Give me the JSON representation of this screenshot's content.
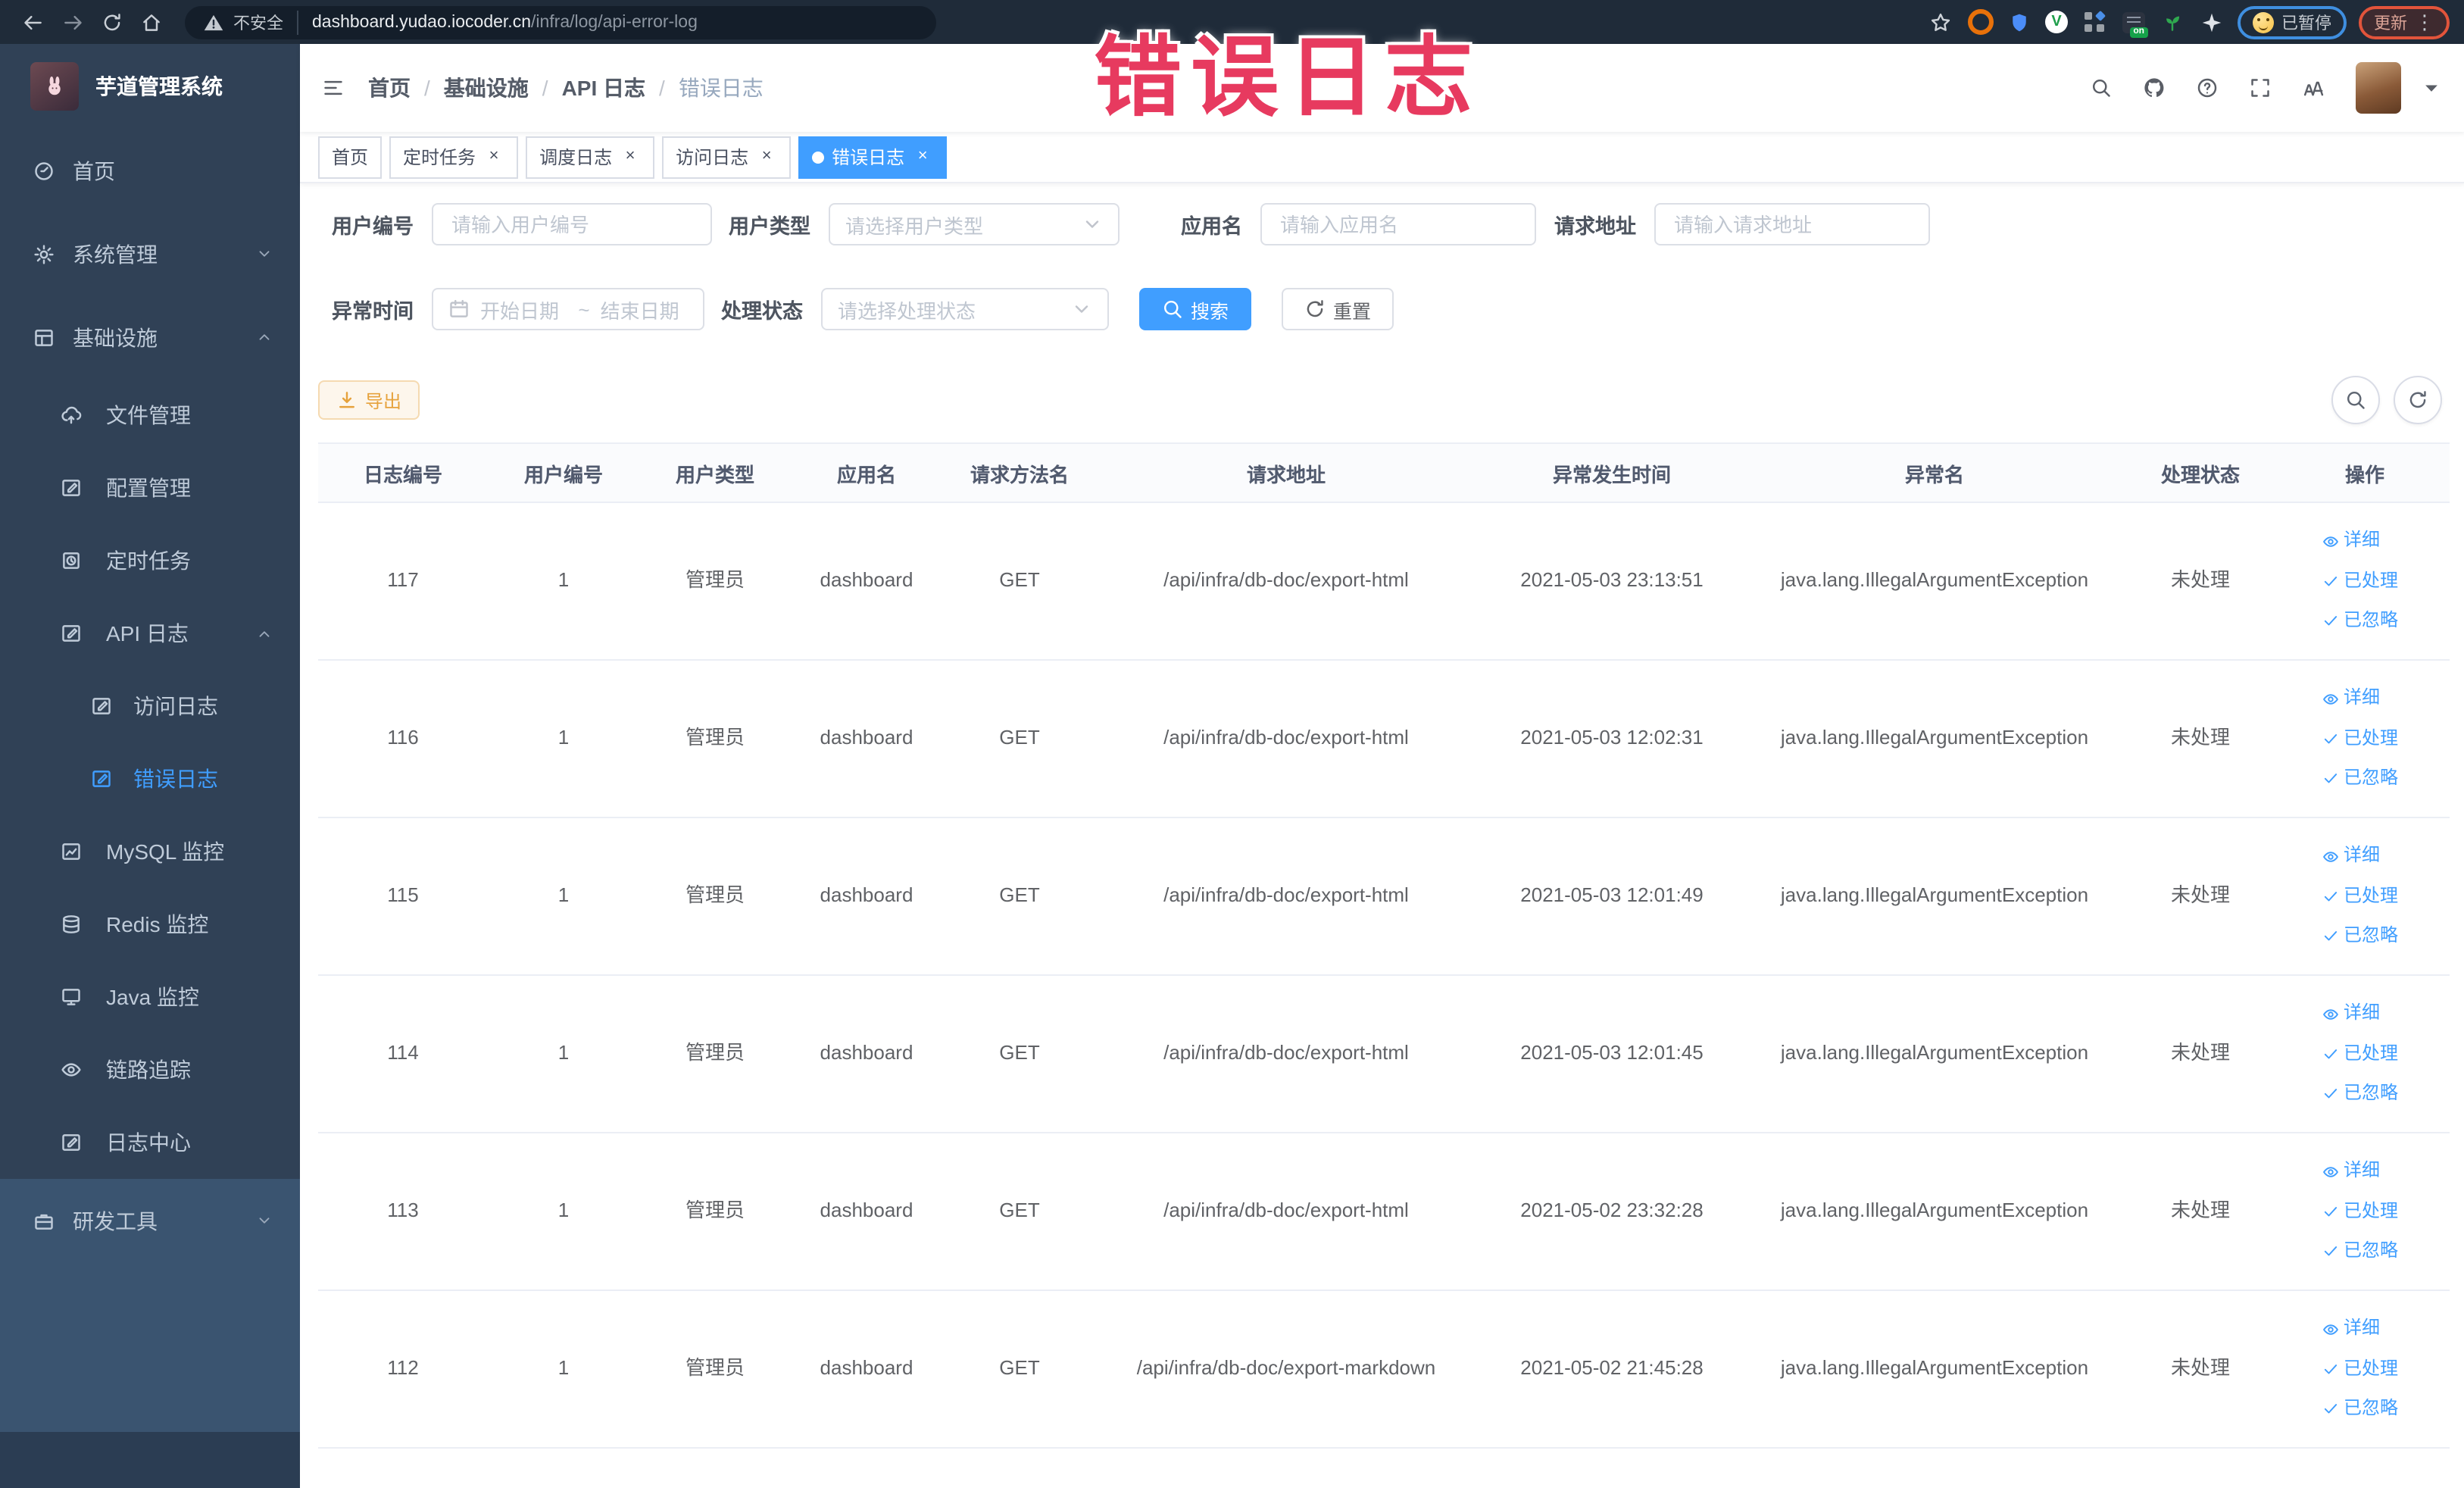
{
  "browser": {
    "security_label": "不安全",
    "url_host": "dashboard.yudao.iocoder.cn",
    "url_path": "/infra/log/api-error-log",
    "paused_label": "已暂停",
    "update_label": "更新",
    "on_badge": "on",
    "ext_v_letter": "V"
  },
  "annotation": {
    "text": "错误日志",
    "color": "#e73a5f"
  },
  "glyphs": {
    "close": "×",
    "kebab": "⋮",
    "slash": "/"
  },
  "sidebar": {
    "title": "芋道管理系统",
    "items": [
      {
        "label": "首页",
        "icon": "dashboard",
        "level": 1
      },
      {
        "label": "系统管理",
        "icon": "gear",
        "level": 1,
        "chevron": "down"
      },
      {
        "label": "基础设施",
        "icon": "infra",
        "level": 1,
        "chevron": "up"
      },
      {
        "label": "文件管理",
        "icon": "cloud",
        "level": 2
      },
      {
        "label": "配置管理",
        "icon": "pen",
        "level": 2
      },
      {
        "label": "定时任务",
        "icon": "job",
        "level": 2
      },
      {
        "label": "API 日志",
        "icon": "pen",
        "level": 2,
        "chevron": "up"
      },
      {
        "label": "访问日志",
        "icon": "pen",
        "level": 3
      },
      {
        "label": "错误日志",
        "icon": "pen",
        "level": 3,
        "active": true
      },
      {
        "label": "MySQL 监控",
        "icon": "mysql",
        "level": 2
      },
      {
        "label": "Redis 监控",
        "icon": "redis",
        "level": 2
      },
      {
        "label": "Java 监控",
        "icon": "java",
        "level": 2
      },
      {
        "label": "链路追踪",
        "icon": "trace",
        "level": 2
      },
      {
        "label": "日志中心",
        "icon": "pen",
        "level": 2
      }
    ],
    "bottom_item": {
      "label": "研发工具",
      "icon": "briefcase",
      "level": 1,
      "chevron": "down"
    }
  },
  "header": {
    "breadcrumb": [
      "首页",
      "基础设施",
      "API 日志",
      "错误日志"
    ]
  },
  "tabs": [
    {
      "label": "首页",
      "closable": false,
      "active": false
    },
    {
      "label": "定时任务",
      "closable": true,
      "active": false
    },
    {
      "label": "调度日志",
      "closable": true,
      "active": false
    },
    {
      "label": "访问日志",
      "closable": true,
      "active": false
    },
    {
      "label": "错误日志",
      "closable": true,
      "active": true
    }
  ],
  "filters": {
    "user_id": {
      "label": "用户编号",
      "placeholder": "请输入用户编号"
    },
    "user_type": {
      "label": "用户类型",
      "placeholder": "请选择用户类型"
    },
    "app_name": {
      "label": "应用名",
      "placeholder": "请输入应用名"
    },
    "request_url": {
      "label": "请求地址",
      "placeholder": "请输入请求地址"
    },
    "exception_time": {
      "label": "异常时间",
      "start_placeholder": "开始日期",
      "separator": "~",
      "end_placeholder": "结束日期"
    },
    "process_status": {
      "label": "处理状态",
      "placeholder": "请选择处理状态"
    },
    "search_label": "搜索",
    "reset_label": "重置"
  },
  "toolbar": {
    "export_label": "导出"
  },
  "table": {
    "columns": [
      "日志编号",
      "用户编号",
      "用户类型",
      "应用名",
      "请求方法名",
      "请求地址",
      "异常发生时间",
      "异常名",
      "处理状态",
      "操作"
    ],
    "action_labels": [
      "详细",
      "已处理",
      "已忽略"
    ],
    "rows": [
      {
        "id": "117",
        "user_id": "1",
        "user_type": "管理员",
        "app": "dashboard",
        "method": "GET",
        "url": "/api/infra/db-doc/export-html",
        "time": "2021-05-03 23:13:51",
        "exception": "java.lang.IllegalArgumentException",
        "status": "未处理"
      },
      {
        "id": "116",
        "user_id": "1",
        "user_type": "管理员",
        "app": "dashboard",
        "method": "GET",
        "url": "/api/infra/db-doc/export-html",
        "time": "2021-05-03 12:02:31",
        "exception": "java.lang.IllegalArgumentException",
        "status": "未处理"
      },
      {
        "id": "115",
        "user_id": "1",
        "user_type": "管理员",
        "app": "dashboard",
        "method": "GET",
        "url": "/api/infra/db-doc/export-html",
        "time": "2021-05-03 12:01:49",
        "exception": "java.lang.IllegalArgumentException",
        "status": "未处理"
      },
      {
        "id": "114",
        "user_id": "1",
        "user_type": "管理员",
        "app": "dashboard",
        "method": "GET",
        "url": "/api/infra/db-doc/export-html",
        "time": "2021-05-03 12:01:45",
        "exception": "java.lang.IllegalArgumentException",
        "status": "未处理"
      },
      {
        "id": "113",
        "user_id": "1",
        "user_type": "管理员",
        "app": "dashboard",
        "method": "GET",
        "url": "/api/infra/db-doc/export-html",
        "time": "2021-05-02 23:32:28",
        "exception": "java.lang.IllegalArgumentException",
        "status": "未处理"
      },
      {
        "id": "112",
        "user_id": "1",
        "user_type": "管理员",
        "app": "dashboard",
        "method": "GET",
        "url": "/api/infra/db-doc/export-markdown",
        "time": "2021-05-02 21:45:28",
        "exception": "java.lang.IllegalArgumentException",
        "status": "未处理"
      }
    ]
  },
  "colors": {
    "accent": "#409eff",
    "warning": "#e6a23c",
    "annotation_red": "#e73a5f",
    "sidebar_bg": "#304156",
    "sidebar_text": "#bfcbd9",
    "browser_bar": "#1f2b39"
  }
}
